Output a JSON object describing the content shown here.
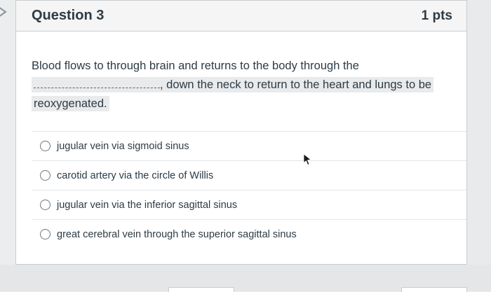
{
  "question": {
    "title": "Question 3",
    "points": "1 pts",
    "stem_part1": "Blood flows to through brain and returns to the body through the",
    "stem_part2": ", down the neck to return to the heart and lungs to be",
    "stem_part3": "reoxygenated."
  },
  "answers": [
    {
      "label": "jugular vein via sigmoid sinus",
      "selected": false
    },
    {
      "label": "carotid artery via the circle of Willis",
      "selected": false
    },
    {
      "label": "jugular vein via the inferior sagittal sinus",
      "selected": false
    },
    {
      "label": "great cerebral vein through the superior sagittal sinus",
      "selected": false
    }
  ],
  "colors": {
    "text": "#2d3b45",
    "header_bg": "#f5f5f5",
    "border": "#c7cdd1",
    "page_bg": "#ecedee"
  },
  "icons": {
    "left_arrow": "chevron-right-icon",
    "cursor": "mouse-pointer-icon",
    "radio": "radio-unchecked-icon"
  }
}
